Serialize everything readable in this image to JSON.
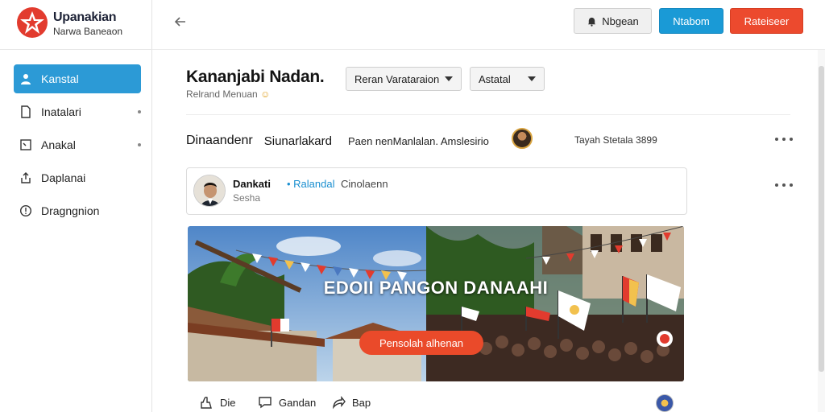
{
  "brand": {
    "title": "Upanakian",
    "subtitle": "Narwa Baneaon",
    "logo_color": "#e23b2e"
  },
  "sidebar": {
    "items": [
      {
        "label": "Kanstal",
        "icon": "user-icon",
        "active": true
      },
      {
        "label": "Inatalari",
        "icon": "document-icon",
        "active": false
      },
      {
        "label": "Anakal",
        "icon": "square-icon",
        "active": false
      },
      {
        "label": "Daplanai",
        "icon": "share-icon",
        "active": false
      },
      {
        "label": "Dragngnion",
        "icon": "info-circle-icon",
        "active": false
      }
    ],
    "accent": "#2c9ad6"
  },
  "topbar": {
    "back_icon": "arrow-left-icon",
    "buttons": [
      {
        "label": "Nbgean",
        "icon": "bell-icon",
        "style": "grey"
      },
      {
        "label": "Ntabom",
        "style": "blue",
        "color": "#1a9ad6"
      },
      {
        "label": "Rateiseer",
        "style": "red",
        "color": "#ec4a2e"
      }
    ]
  },
  "header": {
    "title": "Kananjabi Nadan.",
    "subtitle": "Relrand Menuan",
    "dropdowns": [
      {
        "selected": "Reran Varataraion"
      },
      {
        "selected": "Astatal"
      }
    ]
  },
  "info_strip": {
    "part1": "Dinaandenr",
    "part2": "Siunarlakard",
    "part3": "Paen nenManlalan. Amslesirio",
    "user_info": "Tayah Stetala 3899"
  },
  "post": {
    "author": "Dankati",
    "tag": "Ralandal",
    "meta": "Cinolaenn",
    "sub": "Sesha"
  },
  "banner": {
    "title": "EDOII PANGON DANAAHI",
    "button_label": "Pensolah alhenan"
  },
  "actions": [
    {
      "label": "Die",
      "icon": "like-icon"
    },
    {
      "label": "Gandan",
      "icon": "comment-icon"
    },
    {
      "label": "Bap",
      "icon": "share-arrow-icon"
    }
  ]
}
